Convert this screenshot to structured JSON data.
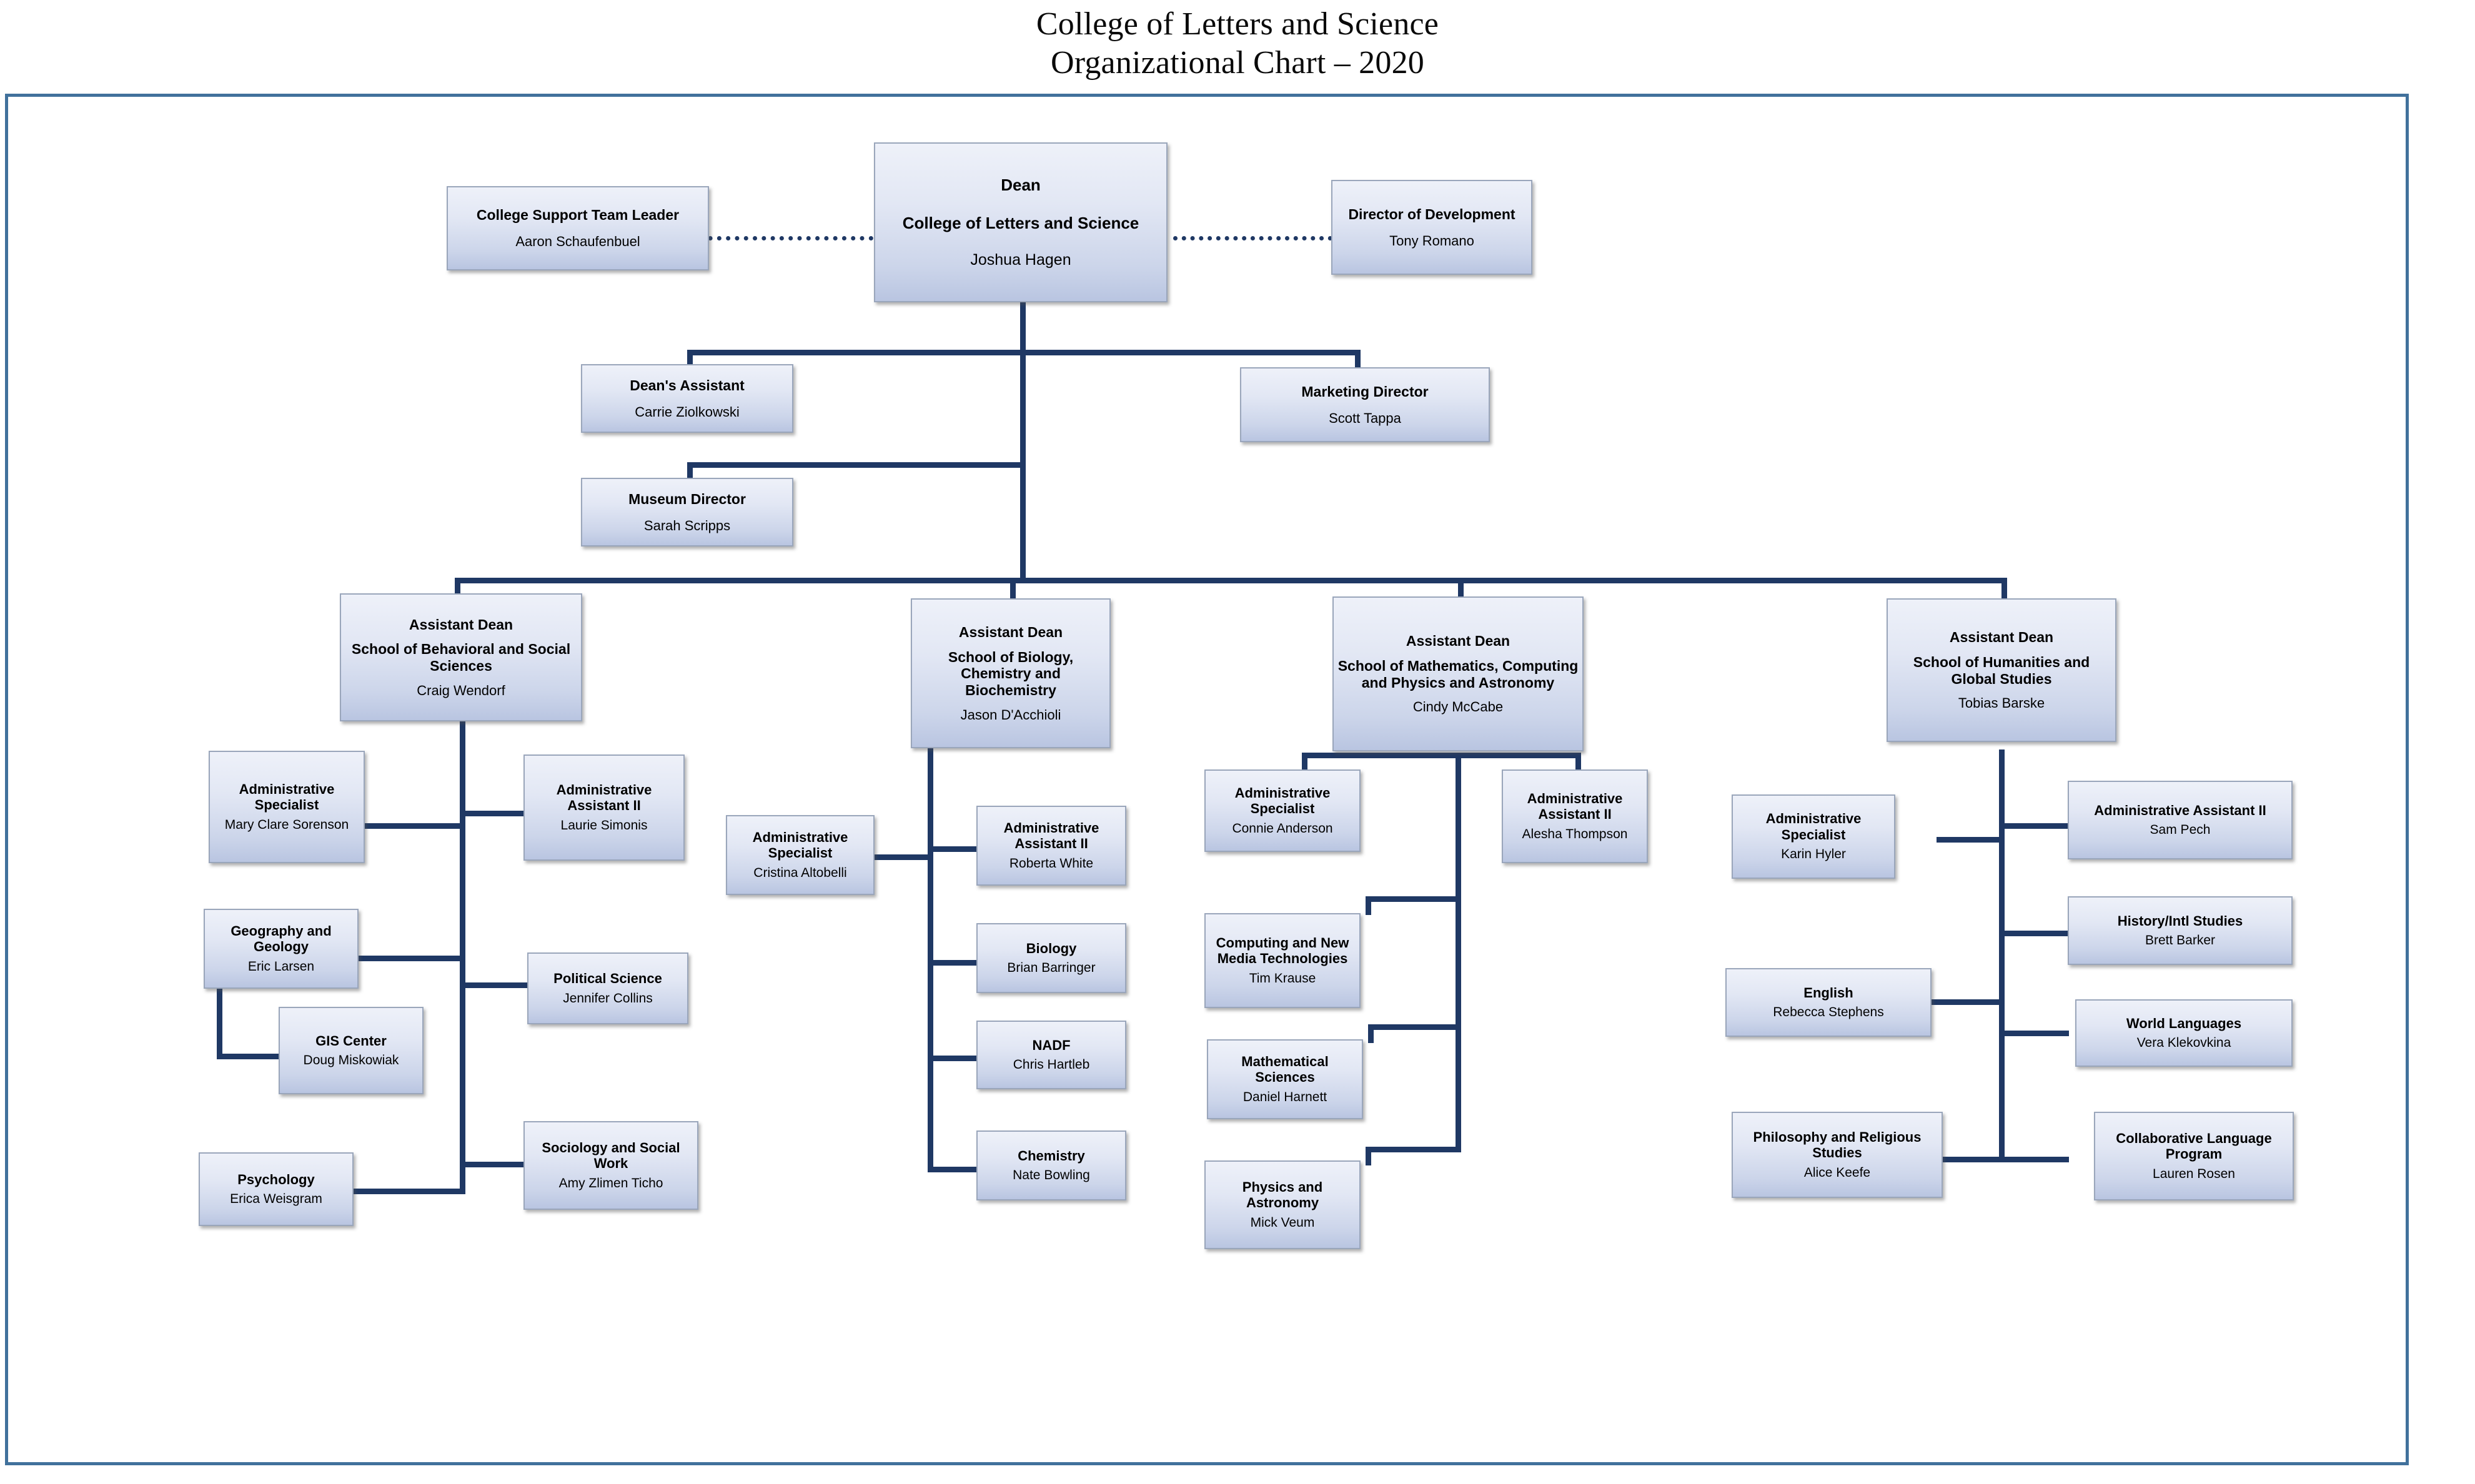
{
  "title": {
    "line1": "College of Letters and Science",
    "line2": "Organizational Chart – 2020"
  },
  "colors": {
    "frame": "#41719C",
    "connector": "#1F3864",
    "box_border": "#9AA6BB",
    "box_top": "#EEF1F9",
    "box_bottom": "#B9C5E1"
  },
  "nodes": {
    "dean": {
      "title": "Dean",
      "subtitle": "College of Letters and Science",
      "person": "Joshua Hagen"
    },
    "support_lead": {
      "title": "College Support Team Leader",
      "person": "Aaron Schaufenbuel"
    },
    "dir_development": {
      "title": "Director of Development",
      "person": "Tony Romano"
    },
    "deans_assistant": {
      "title": "Dean's Assistant",
      "person": "Carrie Ziolkowski"
    },
    "marketing_dir": {
      "title": "Marketing Director",
      "person": "Scott Tappa"
    },
    "museum_dir": {
      "title": "Museum Director",
      "person": "Sarah Scripps"
    },
    "ad_bss": {
      "title": "Assistant Dean",
      "subtitle": "School of Behavioral and Social Sciences",
      "person": "Craig Wendorf"
    },
    "ad_bio": {
      "title": "Assistant Dean",
      "subtitle": "School of Biology, Chemistry and Biochemistry",
      "person": "Jason D'Acchioli"
    },
    "ad_math": {
      "title": "Assistant Dean",
      "subtitle": "School of Mathematics, Computing and Physics and Astronomy",
      "person": "Cindy McCabe"
    },
    "ad_hum": {
      "title": "Assistant Dean",
      "subtitle": "School of Humanities and Global Studies",
      "person": "Tobias Barske"
    },
    "bss_admspec": {
      "title": "Administrative Specialist",
      "person": "Mary Clare Sorenson"
    },
    "bss_admasst": {
      "title": "Administrative Assistant II",
      "person": "Laurie Simonis"
    },
    "bss_geog": {
      "title": "Geography and Geology",
      "person": "Eric Larsen"
    },
    "bss_gis": {
      "title": "GIS Center",
      "person": "Doug Miskowiak"
    },
    "bss_polsci": {
      "title": "Political Science",
      "person": "Jennifer Collins"
    },
    "bss_psych": {
      "title": "Psychology",
      "person": "Erica Weisgram"
    },
    "bss_soc": {
      "title": "Sociology and Social Work",
      "person": "Amy Zlimen Ticho"
    },
    "bio_admspec": {
      "title": "Administrative Specialist",
      "person": "Cristina Altobelli"
    },
    "bio_admasst": {
      "title": "Administrative Assistant II",
      "person": "Roberta White"
    },
    "bio_biology": {
      "title": "Biology",
      "person": "Brian Barringer"
    },
    "bio_nadf": {
      "title": "NADF",
      "person": "Chris Hartleb"
    },
    "bio_chem": {
      "title": "Chemistry",
      "person": "Nate Bowling"
    },
    "math_admspec": {
      "title": "Administrative Specialist",
      "person": "Connie Anderson"
    },
    "math_admasst": {
      "title": "Administrative Assistant II",
      "person": "Alesha Thompson"
    },
    "math_cnmt": {
      "title": "Computing and New Media Technologies",
      "person": "Tim Krause"
    },
    "math_mathsci": {
      "title": "Mathematical Sciences",
      "person": "Daniel Harnett"
    },
    "math_physics": {
      "title": "Physics and Astronomy",
      "person": "Mick Veum"
    },
    "hum_admspec": {
      "title": "Administrative Specialist",
      "person": "Karin Hyler"
    },
    "hum_admasst": {
      "title": "Administrative Assistant II",
      "person": "Sam Pech"
    },
    "hum_history": {
      "title": "History/Intl Studies",
      "person": "Brett Barker"
    },
    "hum_english": {
      "title": "English",
      "person": "Rebecca Stephens"
    },
    "hum_world": {
      "title": "World Languages",
      "person": "Vera Klekovkina"
    },
    "hum_phil": {
      "title": "Philosophy and Religious Studies",
      "person": "Alice Keefe"
    },
    "hum_collab": {
      "title": "Collaborative Language Program",
      "person": "Lauren Rosen"
    }
  }
}
